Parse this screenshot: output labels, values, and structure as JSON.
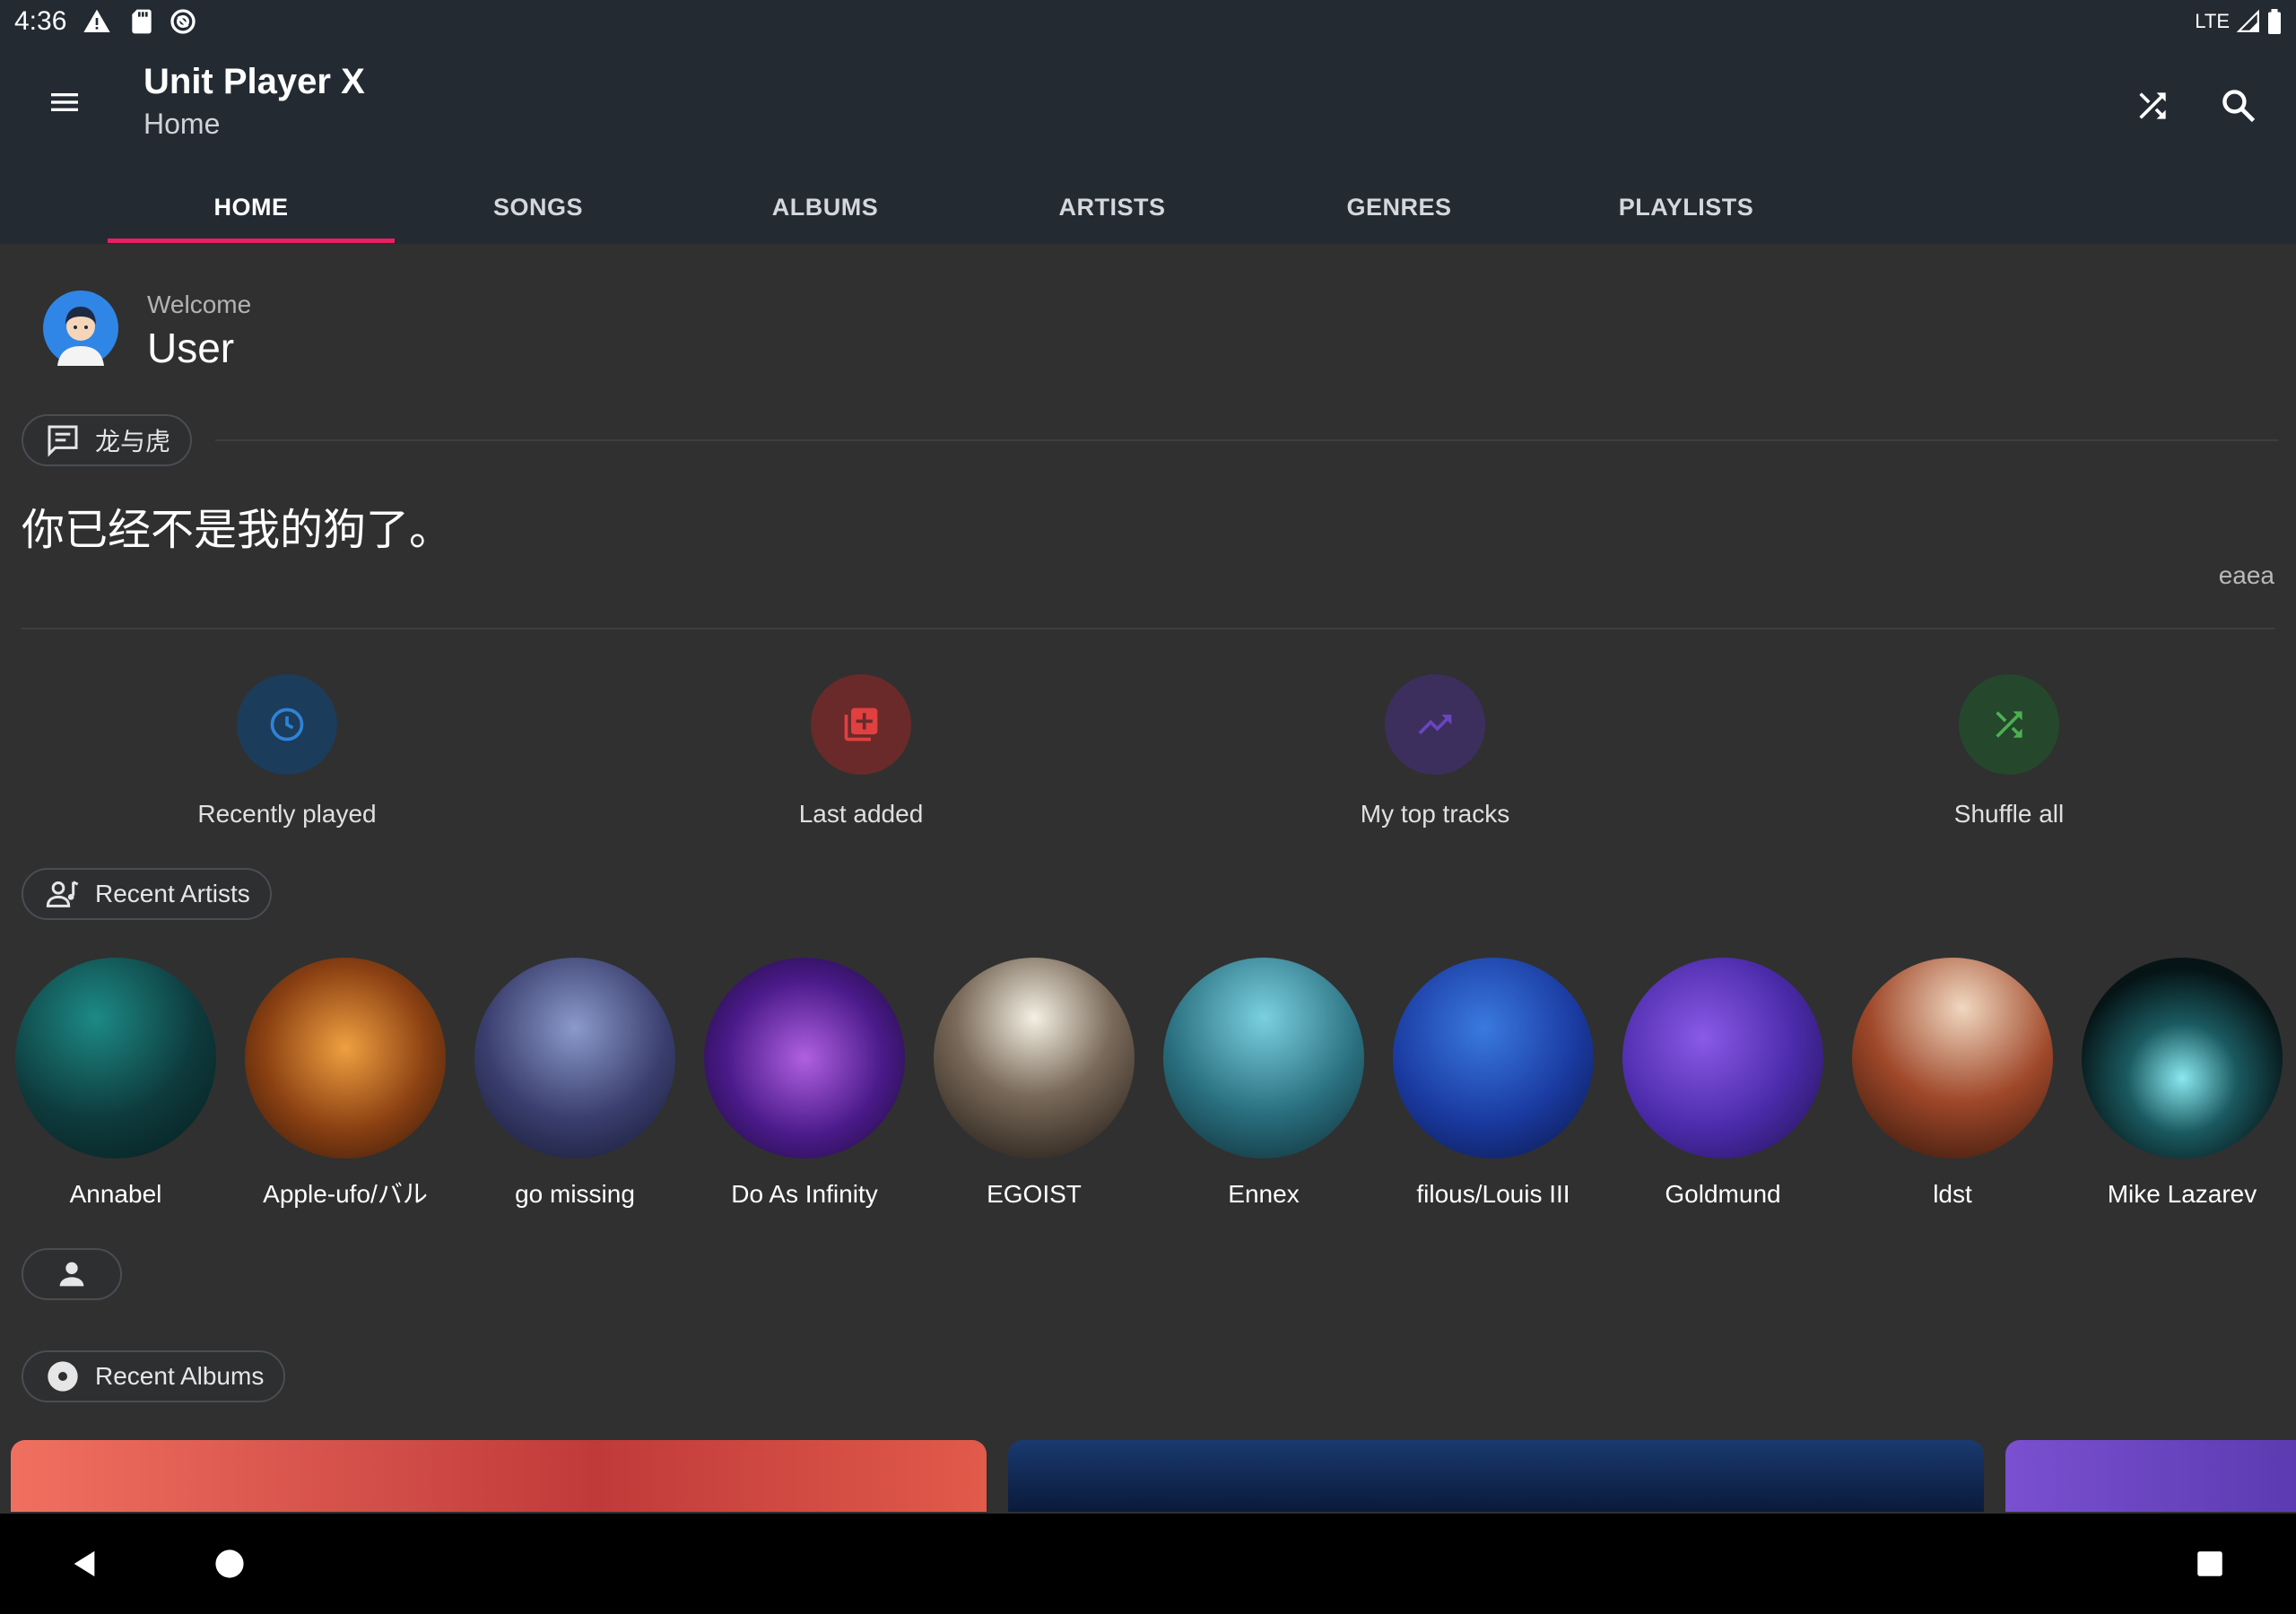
{
  "status_bar": {
    "time": "4:36",
    "network": "LTE"
  },
  "app_bar": {
    "title": "Unit Player X",
    "subtitle": "Home"
  },
  "tabs": [
    {
      "label": "HOME",
      "active": true
    },
    {
      "label": "SONGS",
      "active": false
    },
    {
      "label": "ALBUMS",
      "active": false
    },
    {
      "label": "ARTISTS",
      "active": false
    },
    {
      "label": "GENRES",
      "active": false
    },
    {
      "label": "PLAYLISTS",
      "active": false
    }
  ],
  "welcome": {
    "label": "Welcome",
    "user": "User"
  },
  "lyric": {
    "chip_label": "龙与虎",
    "text": "你已经不是我的狗了。",
    "author": "eaea"
  },
  "quick_actions": [
    {
      "label": "Recently played",
      "icon": "clock-icon",
      "bg": "#1c3c5c",
      "fg": "#2f83d6"
    },
    {
      "label": "Last added",
      "icon": "library-add-icon",
      "bg": "#6a2a2a",
      "fg": "#e0403f"
    },
    {
      "label": "My top tracks",
      "icon": "trending-up-icon",
      "bg": "#3c2f5e",
      "fg": "#6a45c0"
    },
    {
      "label": "Shuffle all",
      "icon": "shuffle-icon",
      "bg": "#25472c",
      "fg": "#4caf50"
    }
  ],
  "recent_artists": {
    "title": "Recent Artists",
    "items": [
      {
        "name": "Annabel",
        "colors": [
          "#1c8a86",
          "#0e3a3c",
          "#061c1e"
        ]
      },
      {
        "name": "Apple-ufo/バル",
        "colors": [
          "#f0a040",
          "#8a4012",
          "#2a140a"
        ]
      },
      {
        "name": "go missing",
        "colors": [
          "#8a9acb",
          "#3a3e6e",
          "#141830"
        ]
      },
      {
        "name": "Do As Infinity",
        "colors": [
          "#b060e0",
          "#4a1a8a",
          "#160a2c"
        ]
      },
      {
        "name": "EGOIST",
        "colors": [
          "#f4f0e4",
          "#7a6a5a",
          "#1a1410"
        ]
      },
      {
        "name": "Ennex",
        "colors": [
          "#7ad0e0",
          "#2a7080",
          "#0e2a32"
        ]
      },
      {
        "name": "filous/Louis III",
        "colors": [
          "#3a7ae0",
          "#1a3aa0",
          "#0a1440"
        ]
      },
      {
        "name": "Goldmund",
        "colors": [
          "#8a5ae8",
          "#4a2aa8",
          "#1e104a"
        ]
      },
      {
        "name": "ldst",
        "colors": [
          "#f0d8c0",
          "#a0482a",
          "#2a1208"
        ]
      },
      {
        "name": "Mike Lazarev",
        "colors": [
          "#8ae8f0",
          "#1a5a60",
          "#061416"
        ]
      }
    ]
  },
  "recent_albums": {
    "title": "Recent Albums",
    "items": [
      {
        "colors": [
          "#f07060",
          "#c03a3a"
        ]
      },
      {
        "colors": [
          "#1a3a70",
          "#0a1a3a"
        ]
      },
      {
        "colors": [
          "#7a50d0",
          "#5a3ab0"
        ]
      }
    ]
  },
  "colors": {
    "accent": "#e91e63",
    "app_bar": "#232a32",
    "background": "#303030"
  }
}
